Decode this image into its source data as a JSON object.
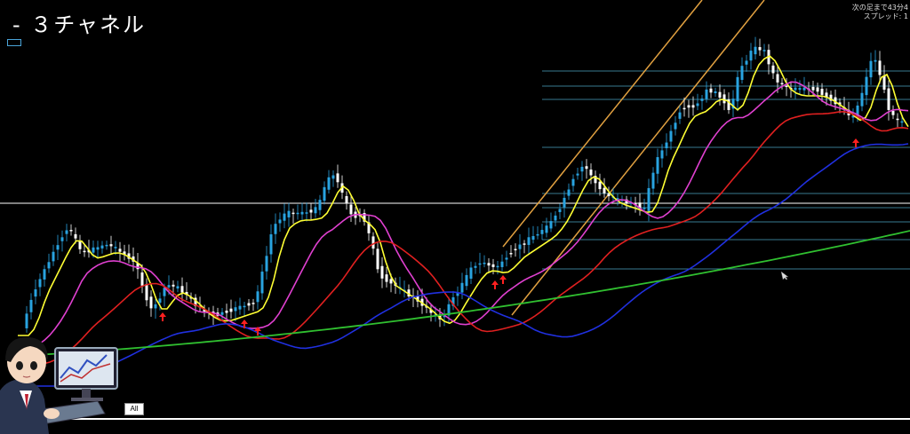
{
  "window": {
    "title": "- ３チャネル",
    "info_line1": "次の足まで43分4",
    "info_line2": "スプレッド: 1"
  },
  "controls": {
    "all_button": "All"
  },
  "colors": {
    "background": "#000000",
    "bull_candle": "#29a3e0",
    "bear_candle": "#ffffff",
    "ma_fast": "#ffff33",
    "ma_mid": "#e040d0",
    "ma_slow1": "#e02020",
    "ma_slow2": "#2030e0",
    "ma_long": "#30c030",
    "channel": "#e0a040",
    "hline": "#4aa3c0",
    "signal_arrow": "#ff2020"
  },
  "icons": {
    "cursor": "mouse-cursor-icon",
    "avatar": "character-avatar-icon"
  }
}
